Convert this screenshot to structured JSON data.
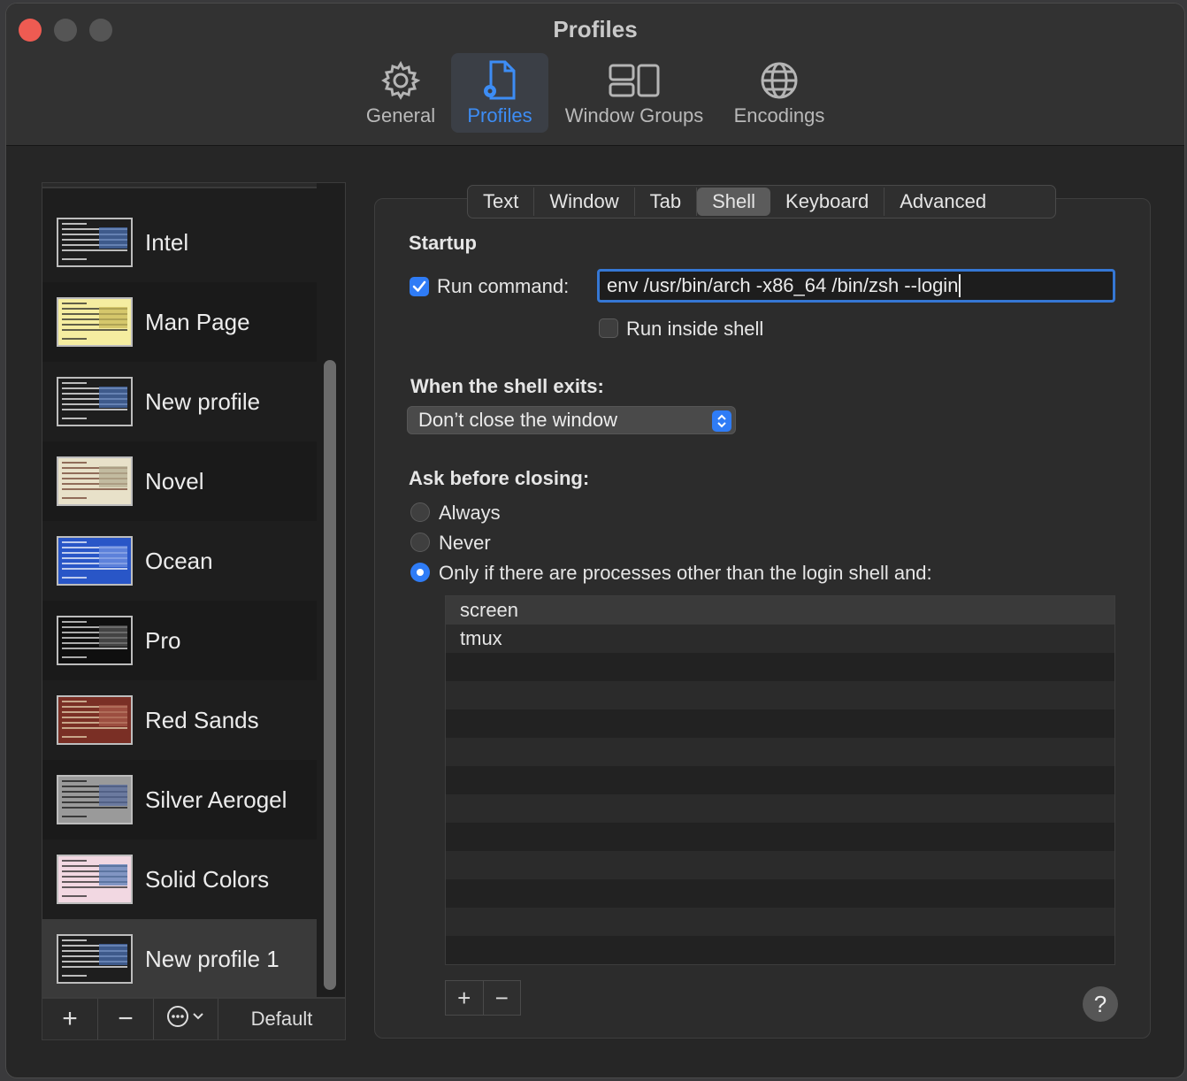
{
  "window": {
    "title": "Profiles"
  },
  "toolbar": {
    "items": [
      {
        "label": "General",
        "icon": "gear-icon",
        "active": false
      },
      {
        "label": "Profiles",
        "icon": "profiles-doc-icon",
        "active": true
      },
      {
        "label": "Window Groups",
        "icon": "window-groups-icon",
        "active": false
      },
      {
        "label": "Encodings",
        "icon": "globe-icon",
        "active": false
      }
    ]
  },
  "sidebar": {
    "profiles": [
      {
        "name": "Intel",
        "bg": "#1e1e1e",
        "fg": "#ffffff",
        "hl": "#4a6fb0"
      },
      {
        "name": "Man Page",
        "bg": "#f5eda0",
        "fg": "#222222",
        "hl": "#c9b95a"
      },
      {
        "name": "New profile",
        "bg": "#1e1e1e",
        "fg": "#ffffff",
        "hl": "#4a6fb0"
      },
      {
        "name": "Novel",
        "bg": "#e8e1c9",
        "fg": "#6b3a2a",
        "hl": "#b6ae92"
      },
      {
        "name": "Ocean",
        "bg": "#2956c7",
        "fg": "#ffffff",
        "hl": "#6f90e0"
      },
      {
        "name": "Pro",
        "bg": "#0f0f0f",
        "fg": "#eeeeee",
        "hl": "#555555"
      },
      {
        "name": "Red Sands",
        "bg": "#7a2f25",
        "fg": "#e9d8b5",
        "hl": "#a85a4a"
      },
      {
        "name": "Silver Aerogel",
        "bg": "#9a9a9a",
        "fg": "#111111",
        "hl": "#5b6fa0"
      },
      {
        "name": "Solid Colors",
        "bg": "#f2d8e2",
        "fg": "#222222",
        "hl": "#5b7fb8"
      },
      {
        "name": "New profile 1",
        "bg": "#1e1e1e",
        "fg": "#ffffff",
        "hl": "#4a6fb0"
      }
    ],
    "selected": "New profile 1",
    "bottom": {
      "add": "+",
      "remove": "−",
      "more": "⋯",
      "default_label": "Default"
    }
  },
  "tabs": [
    {
      "label": "Text",
      "active": false
    },
    {
      "label": "Window",
      "active": false
    },
    {
      "label": "Tab",
      "active": false
    },
    {
      "label": "Shell",
      "active": true
    },
    {
      "label": "Keyboard",
      "active": false
    },
    {
      "label": "Advanced",
      "active": false
    }
  ],
  "shell": {
    "startup_heading": "Startup",
    "run_command_label": "Run command:",
    "run_command_checked": true,
    "run_command_value": "env /usr/bin/arch -x86_64 /bin/zsh --login",
    "run_inside_shell_label": "Run inside shell",
    "run_inside_shell_checked": false,
    "exit_heading": "When the shell exits:",
    "exit_option": "Don’t close the window",
    "ask_heading": "Ask before closing:",
    "ask_options": [
      {
        "label": "Always",
        "selected": false
      },
      {
        "label": "Never",
        "selected": false
      },
      {
        "label": "Only if there are processes other than the login shell and:",
        "selected": true
      }
    ],
    "processes": [
      "screen",
      "tmux"
    ],
    "process_add": "+",
    "process_remove": "−",
    "help": "?"
  },
  "colors": {
    "accent": "#2f7cf6",
    "close": "#ee5b52"
  }
}
